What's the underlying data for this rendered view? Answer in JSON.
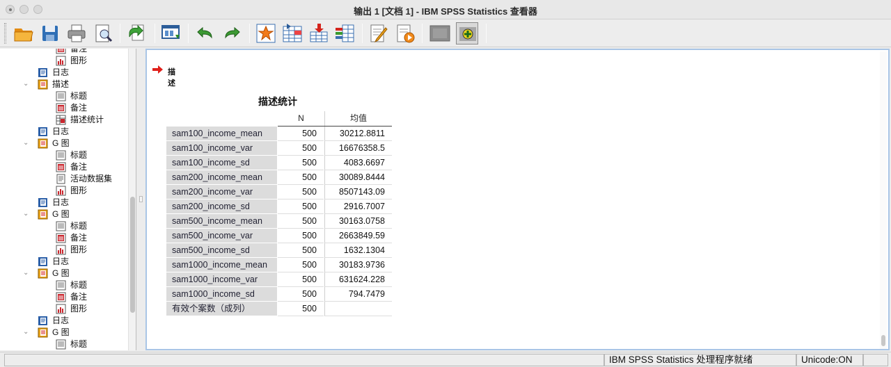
{
  "window": {
    "title": "输出 1 [文档 1] - IBM SPSS Statistics 查看器"
  },
  "toolbar": {
    "buttons": [
      {
        "name": "open",
        "icon": "folder-open-icon"
      },
      {
        "name": "save",
        "icon": "floppy-disk-icon"
      },
      {
        "name": "print",
        "icon": "printer-icon"
      },
      {
        "name": "print-preview",
        "icon": "print-preview-icon"
      },
      {
        "name": "export",
        "icon": "export-icon"
      },
      {
        "name": "recall-dialog",
        "icon": "dialog-recall-icon"
      },
      {
        "name": "undo",
        "icon": "undo-arrow-icon"
      },
      {
        "name": "redo",
        "icon": "redo-arrow-icon"
      },
      {
        "name": "goto-case",
        "icon": "star-icon"
      },
      {
        "name": "goto-variable",
        "icon": "variable-icon"
      },
      {
        "name": "insert-cases",
        "icon": "insert-cases-icon"
      },
      {
        "name": "insert-variable",
        "icon": "insert-variable-icon"
      },
      {
        "name": "edit-output",
        "icon": "edit-output-icon"
      },
      {
        "name": "run-script",
        "icon": "run-script-icon"
      },
      {
        "name": "hide",
        "icon": "hide-icon"
      },
      {
        "name": "show",
        "icon": "show-add-icon"
      }
    ]
  },
  "tree": {
    "items": [
      {
        "label": "备注",
        "level": 2,
        "icon": "notes-icon"
      },
      {
        "label": "图形",
        "level": 2,
        "icon": "chart-icon"
      },
      {
        "label": "日志",
        "level": 1,
        "icon": "log-book-icon"
      },
      {
        "label": "描述",
        "level": 1,
        "icon": "procedure-book-icon",
        "expanded": true
      },
      {
        "label": "标题",
        "level": 2,
        "icon": "title-icon"
      },
      {
        "label": "备注",
        "level": 2,
        "icon": "notes-icon"
      },
      {
        "label": "描述统计",
        "level": 2,
        "icon": "table-icon"
      },
      {
        "label": "日志",
        "level": 1,
        "icon": "log-book-icon"
      },
      {
        "label": "G 图",
        "level": 1,
        "icon": "procedure-book-icon",
        "expanded": true
      },
      {
        "label": "标题",
        "level": 2,
        "icon": "title-icon"
      },
      {
        "label": "备注",
        "level": 2,
        "icon": "notes-icon"
      },
      {
        "label": "活动数据集",
        "level": 2,
        "icon": "dataset-icon"
      },
      {
        "label": "图形",
        "level": 2,
        "icon": "chart-icon"
      },
      {
        "label": "日志",
        "level": 1,
        "icon": "log-book-icon"
      },
      {
        "label": "G 图",
        "level": 1,
        "icon": "procedure-book-icon",
        "expanded": true
      },
      {
        "label": "标题",
        "level": 2,
        "icon": "title-icon"
      },
      {
        "label": "备注",
        "level": 2,
        "icon": "notes-icon"
      },
      {
        "label": "图形",
        "level": 2,
        "icon": "chart-icon"
      },
      {
        "label": "日志",
        "level": 1,
        "icon": "log-book-icon"
      },
      {
        "label": "G 图",
        "level": 1,
        "icon": "procedure-book-icon",
        "expanded": true
      },
      {
        "label": "标题",
        "level": 2,
        "icon": "title-icon"
      },
      {
        "label": "备注",
        "level": 2,
        "icon": "notes-icon"
      },
      {
        "label": "图形",
        "level": 2,
        "icon": "chart-icon"
      },
      {
        "label": "日志",
        "level": 1,
        "icon": "log-book-icon"
      },
      {
        "label": "G 图",
        "level": 1,
        "icon": "procedure-book-icon",
        "expanded": true
      },
      {
        "label": "标题",
        "level": 2,
        "icon": "title-icon"
      }
    ]
  },
  "output": {
    "heading": "描述",
    "table": {
      "title": "描述统计",
      "columns": [
        "N",
        "均值"
      ],
      "rows": [
        {
          "label": "sam100_income_mean",
          "n": "500",
          "mean": "30212.8811"
        },
        {
          "label": "sam100_income_var",
          "n": "500",
          "mean": "16676358.5"
        },
        {
          "label": "sam100_income_sd",
          "n": "500",
          "mean": "4083.6697"
        },
        {
          "label": "sam200_income_mean",
          "n": "500",
          "mean": "30089.8444"
        },
        {
          "label": "sam200_income_var",
          "n": "500",
          "mean": "8507143.09"
        },
        {
          "label": "sam200_income_sd",
          "n": "500",
          "mean": "2916.7007"
        },
        {
          "label": "sam500_income_mean",
          "n": "500",
          "mean": "30163.0758"
        },
        {
          "label": "sam500_income_var",
          "n": "500",
          "mean": "2663849.59"
        },
        {
          "label": "sam500_income_sd",
          "n": "500",
          "mean": "1632.1304"
        },
        {
          "label": "sam1000_income_mean",
          "n": "500",
          "mean": "30183.9736"
        },
        {
          "label": "sam1000_income_var",
          "n": "500",
          "mean": "631624.228"
        },
        {
          "label": "sam1000_income_sd",
          "n": "500",
          "mean": "794.7479"
        },
        {
          "label": "有效个案数（成列）",
          "n": "500",
          "mean": ""
        }
      ]
    }
  },
  "status": {
    "processor": "IBM SPSS Statistics 处理程序就绪",
    "unicode": "Unicode:ON"
  },
  "colors": {
    "selection_border": "#a9c5e6",
    "row_label_bg": "#dcdcdc",
    "arrow_red": "#e0201b"
  }
}
